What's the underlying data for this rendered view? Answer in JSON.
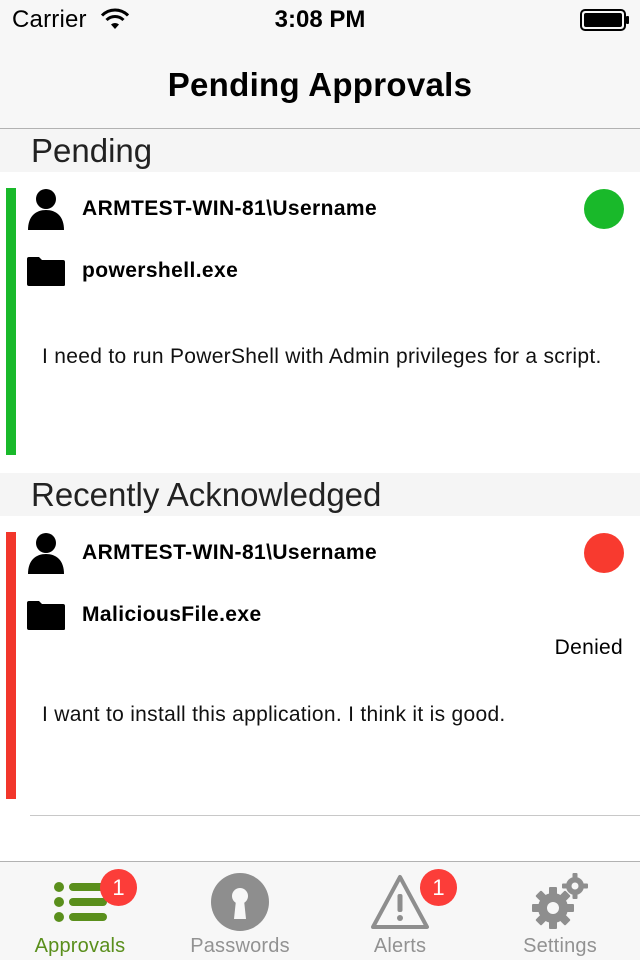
{
  "status_bar": {
    "carrier": "Carrier",
    "time": "3:08 PM"
  },
  "nav": {
    "title": "Pending Approvals"
  },
  "sections": {
    "pending": {
      "header": "Pending",
      "items": [
        {
          "user": "ARMTEST-WIN-81\\Username",
          "file": "powershell.exe",
          "message": "I need to run PowerShell with Admin privileges for a script.",
          "status_color": "#19b92a"
        }
      ]
    },
    "recent": {
      "header": "Recently Acknowledged",
      "items": [
        {
          "user": "ARMTEST-WIN-81\\Username",
          "file": "MaliciousFile.exe",
          "status": "Denied",
          "message": "I want to install this application. I think it is good.",
          "status_color": "#f83a2f"
        }
      ]
    }
  },
  "tabs": [
    {
      "label": "Approvals",
      "icon": "list-icon",
      "badge": "1",
      "active": true
    },
    {
      "label": "Passwords",
      "icon": "keyhole-icon",
      "active": false
    },
    {
      "label": "Alerts",
      "icon": "warning-icon",
      "badge": "1",
      "active": false
    },
    {
      "label": "Settings",
      "icon": "gears-icon",
      "active": false
    }
  ],
  "colors": {
    "accent_active": "#5a8f1c",
    "approved": "#19b92a",
    "denied": "#f2362b",
    "badge": "#fc3d39"
  }
}
